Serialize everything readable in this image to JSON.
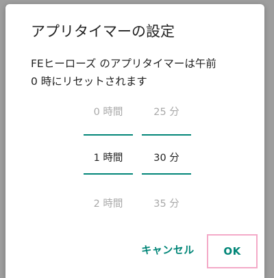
{
  "dialog": {
    "title": "アプリタイマーの設定",
    "message_line1": "FEヒーローズ のアプリタイマーは午前",
    "message_line2": "0 時にリセットされます"
  },
  "picker": {
    "hours": {
      "above": "0 時間",
      "selected": "1 時間",
      "below": "2 時間"
    },
    "minutes": {
      "above": "25 分",
      "selected": "30 分",
      "below": "35 分"
    }
  },
  "buttons": {
    "cancel_label": "キャンセル",
    "ok_label": "OK"
  },
  "colors": {
    "accent": "#008577",
    "highlight_border": "#f4a9c7"
  }
}
